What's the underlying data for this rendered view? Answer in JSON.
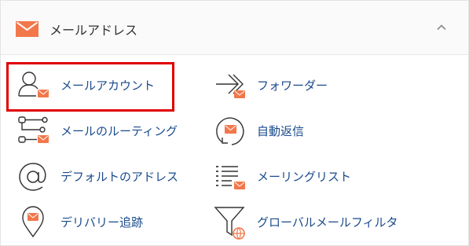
{
  "section": {
    "title": "メールアドレス",
    "header_icon": "envelope-icon",
    "collapse_icon": "chevron-up-icon"
  },
  "items": [
    {
      "label": "メールアカウント",
      "icon": "user-mail-icon"
    },
    {
      "label": "フォワーダー",
      "icon": "forward-arrows-icon"
    },
    {
      "label": "メールのルーティング",
      "icon": "routing-icon"
    },
    {
      "label": "自動返信",
      "icon": "autoresponder-icon"
    },
    {
      "label": "デフォルトのアドレス",
      "icon": "at-sign-icon"
    },
    {
      "label": "メーリングリスト",
      "icon": "mailing-list-icon"
    },
    {
      "label": "デリバリー追跡",
      "icon": "location-pin-mail-icon"
    },
    {
      "label": "グローバルメールフィルタ",
      "icon": "filter-globe-icon"
    }
  ],
  "colors": {
    "accent": "#f2784b",
    "link": "#1a4a8c",
    "highlight": "#e00000"
  }
}
